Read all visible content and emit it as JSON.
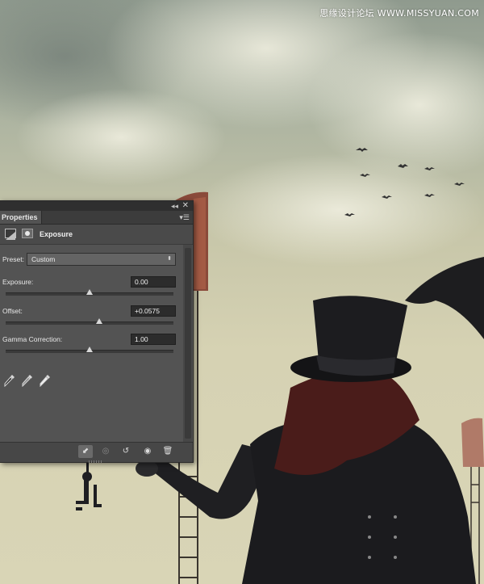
{
  "watermark": "思缘设计论坛 WWW.MISSYUAN.COM",
  "panel": {
    "tab_label": "Properties",
    "collapse_glyph": "◂◂",
    "close_glyph": "✕",
    "menu_glyph": "▾☰",
    "adjustment_title": "Exposure",
    "preset": {
      "label": "Preset:",
      "value": "Custom",
      "arrows": "⬍"
    },
    "exposure": {
      "label": "Exposure:",
      "value": "0.00",
      "slider_fraction": 0.5
    },
    "offset": {
      "label": "Offset:",
      "value": "+0.0575",
      "slider_fraction": 0.56
    },
    "gamma": {
      "label": "Gamma Correction:",
      "value": "1.00",
      "slider_fraction": 0.5
    },
    "bottom_icons": [
      {
        "name": "clip-to-layer-icon",
        "glyph": "⬋",
        "active": true
      },
      {
        "name": "view-previous-state-icon",
        "glyph": "◎",
        "active": false,
        "dim": true
      },
      {
        "name": "reset-icon",
        "glyph": "↺",
        "active": false
      },
      {
        "name": "visibility-eye-icon",
        "glyph": "◉",
        "active": false
      },
      {
        "name": "delete-icon",
        "glyph": "🗑",
        "active": false
      }
    ]
  },
  "colors": {
    "panel_bg": "#535353",
    "panel_dark": "#2f2f2f",
    "field_bg": "#2c2c2c",
    "text": "#e8e8e8"
  }
}
